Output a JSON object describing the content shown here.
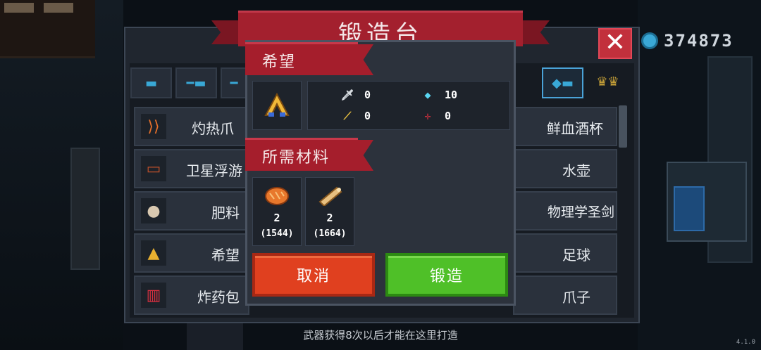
{
  "title": "锻造台",
  "currency": {
    "icon": "gem-icon",
    "value": "374873"
  },
  "weapon_tabs": [
    "pistol-icon",
    "rifle-icon",
    "shotgun-icon",
    "fish-gun-icon",
    "crown-icon"
  ],
  "list_left": [
    {
      "label": "灼热爪",
      "icon": "claw-icon"
    },
    {
      "label": "卫星浮游",
      "icon": "satellite-icon"
    },
    {
      "label": "肥料",
      "icon": "fertilizer-bag-icon"
    },
    {
      "label": "希望",
      "icon": "hope-icon"
    },
    {
      "label": "炸药包",
      "icon": "dynamite-icon"
    }
  ],
  "list_right": [
    {
      "label": "鲜血酒杯"
    },
    {
      "label": "水壶"
    },
    {
      "label": "物理学圣剑"
    },
    {
      "label": "足球"
    },
    {
      "label": "爪子"
    }
  ],
  "dialog": {
    "item_name": "希望",
    "stats": {
      "attack": "0",
      "energy": "10",
      "crit": "0",
      "accuracy": "0"
    },
    "materials_header": "所需材料",
    "materials": [
      {
        "name": "bread-icon",
        "qty": "2",
        "owned": "(1544)"
      },
      {
        "name": "wood-log-icon",
        "qty": "2",
        "owned": "(1664)"
      }
    ],
    "cancel_label": "取消",
    "forge_label": "锻造"
  },
  "hint": "武器获得8次以后才能在这里打造",
  "version": "4.1.0"
}
